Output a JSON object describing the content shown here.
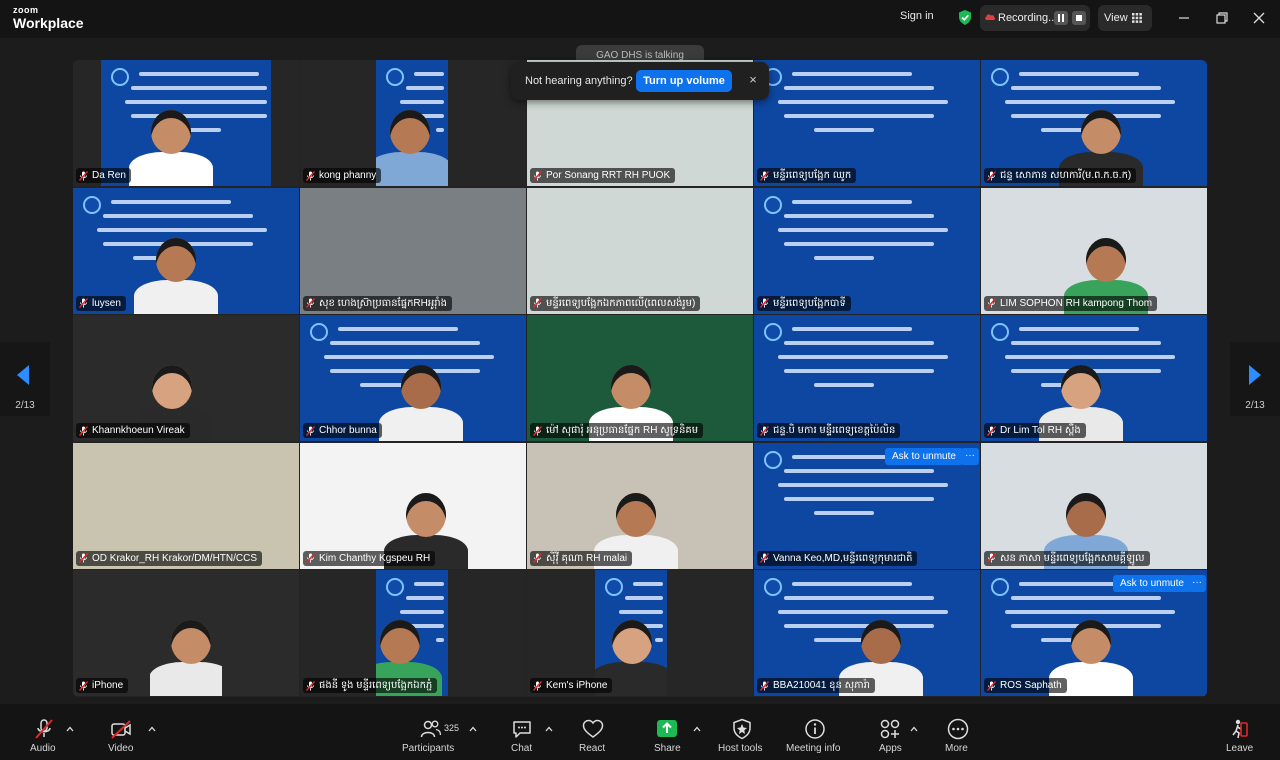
{
  "app": {
    "brand_top": "zoom",
    "brand_main": "Workplace"
  },
  "titlebar": {
    "sign_in": "Sign in",
    "recording_label": "Recording...",
    "view_label": "View",
    "colors": {
      "shield": "#1db954",
      "recording_cloud": "#e04040"
    }
  },
  "overlay": {
    "speaker_badge": "GAO DHS is talking",
    "toast_message": "Not hearing anything?",
    "toast_button": "Turn up volume",
    "toast_close": "×"
  },
  "pager": {
    "left_page": "2/13",
    "right_page": "2/13"
  },
  "tiles": [
    {
      "name": "Da Ren",
      "bg": "banner"
    },
    {
      "name": "kong phanny",
      "bg": "banner"
    },
    {
      "name": "Por Sonang RRT RH PUOK",
      "bg": "room"
    },
    {
      "name": "មន្ទីរពេទ្យបង្អែក ឈូក",
      "bg": "banner"
    },
    {
      "name": "ជន្ទ សោភាន សហការី(ម.ព.ក.ច.ក)",
      "bg": "banner"
    },
    {
      "name": "luysen",
      "bg": "banner"
    },
    {
      "name": "សុខ ហេងស្រ៊ាប្រធានផ្នែកRHអូរ៉ាំង",
      "bg": "ceiling"
    },
    {
      "name": "មន្ទីរពេទ្យបង្អែកឯកភាពលើ(ពេលសង់រូម)",
      "bg": "room"
    },
    {
      "name": "មន្ទីរពេទ្យបង្អែកបាទី",
      "bg": "banner"
    },
    {
      "name": "LIM SOPHON  RH kampong Thom",
      "bg": "office"
    },
    {
      "name": "Khannkhoeun  Vireak",
      "bg": "dark"
    },
    {
      "name": "Chhor bunna",
      "bg": "banner"
    },
    {
      "name": "ម៉ៅ សុផារ៉ុ អនុប្រធានផ្នែក RH សូទ្រនិគម",
      "bg": "green"
    },
    {
      "name": "ជន្ទ.បិ មការ មន្ទីរពេទ្យខេត្តប៉ៃលិន",
      "bg": "banner"
    },
    {
      "name": "Dr Lim Tol RH ស្ពឺង",
      "bg": "banner"
    },
    {
      "name": "OD Krakor_RH Krakor/DM/HTN/CCS",
      "bg": "hall"
    },
    {
      "name": "Kim Chanthy  Kgspeu RH",
      "bg": "white"
    },
    {
      "name": "ស៊ីវុី គុណា RH malai",
      "bg": "office2"
    },
    {
      "name": "Vanna Keo,MD,មន្ទីរពេទ្យកុមារជាតិ",
      "bg": "banner"
    },
    {
      "name": "សន ភាសា មន្ទីរពេទ្យបង្អែកសាមគ្គីឡូល",
      "bg": "office"
    },
    {
      "name": "iPhone",
      "bg": "dark"
    },
    {
      "name": "ផងនី ទូង មន្ទីរពេទ្យបង្អែកឯកភ្ជំ",
      "bg": "banner"
    },
    {
      "name": "Kem's iPhone",
      "bg": "banner"
    },
    {
      "name": "BBA210041 ឧុន សុភារ៉ា",
      "bg": "banner"
    },
    {
      "name": "ROS Saphath",
      "bg": "banner"
    }
  ],
  "ask_unmute": {
    "label": "Ask to unmute",
    "more": "···"
  },
  "toolbar": {
    "audio": "Audio",
    "video": "Video",
    "participants": "Participants",
    "participant_count": "325",
    "chat": "Chat",
    "react": "React",
    "share": "Share",
    "host_tools": "Host tools",
    "meeting_info": "Meeting info",
    "apps": "Apps",
    "more": "More",
    "leave": "Leave",
    "colors": {
      "share": "#1db954",
      "mute_red": "#e02828",
      "leave": "#e02828",
      "accent": "#0e72ed"
    }
  }
}
